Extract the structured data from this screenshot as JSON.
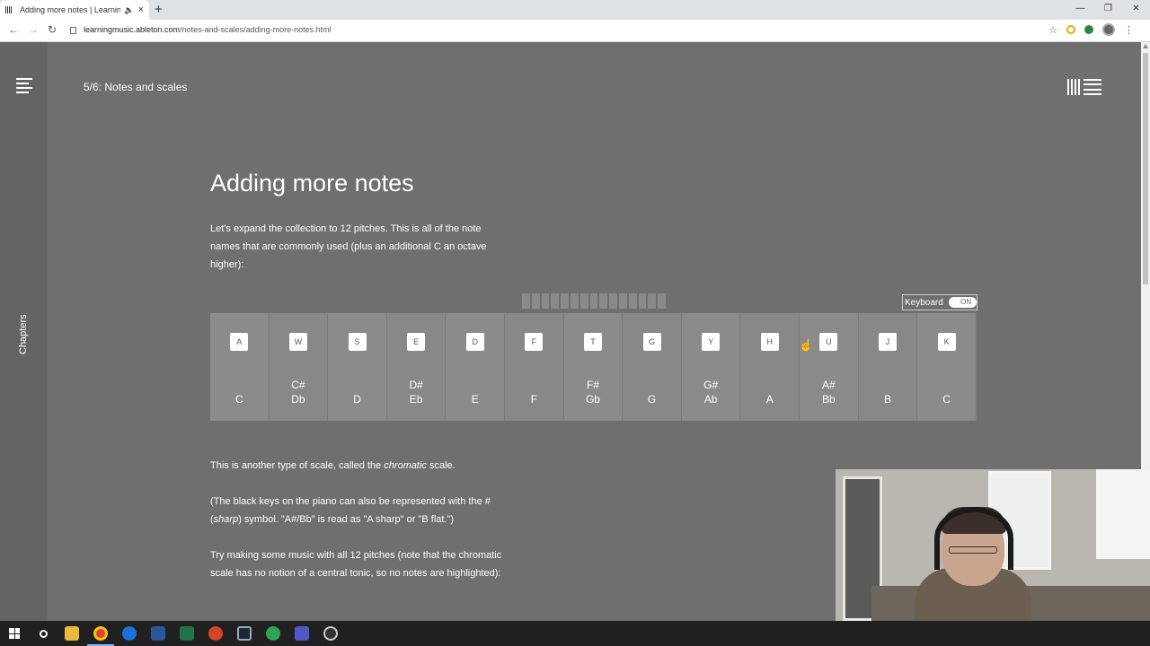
{
  "browser": {
    "tab_title": "Adding more notes | Learnin",
    "tab_close": "×",
    "new_tab": "+",
    "url_host": "learningmusic.ableton.com",
    "url_path": "/notes-and-scales/adding-more-notes.html",
    "win_minimize": "—",
    "win_restore": "❐",
    "win_close": "✕"
  },
  "sidebar": {
    "chapters_label": "Chapters"
  },
  "header": {
    "breadcrumb": "5/6: Notes and scales"
  },
  "main": {
    "title": "Adding more notes",
    "intro": "Let's expand the collection to 12 pitches. This is all of the note names that are commonly used (plus an additional C an octave higher):",
    "chromatic_pre": "This is another type of scale, called the ",
    "chromatic_em": "chromatic",
    "chromatic_post": " scale.",
    "black_keys_pre": "(The black keys on the piano can also be represented with the # (",
    "black_keys_em": "sharp",
    "black_keys_post": ") symbol. \"A#/Bb\" is read as \"A sharp\" or \"B flat.\")",
    "try_text": "Try making some music with all 12 pitches (note that the chromatic scale has no notion of a central tonic, so no notes are highlighted):"
  },
  "keyboard_toggle": {
    "label": "Keyboard",
    "state": "ON"
  },
  "keys": [
    {
      "letter": "A",
      "note1": "C",
      "note2": ""
    },
    {
      "letter": "W",
      "note1": "C#",
      "note2": "Db"
    },
    {
      "letter": "S",
      "note1": "D",
      "note2": ""
    },
    {
      "letter": "E",
      "note1": "D#",
      "note2": "Eb"
    },
    {
      "letter": "D",
      "note1": "E",
      "note2": ""
    },
    {
      "letter": "F",
      "note1": "F",
      "note2": ""
    },
    {
      "letter": "T",
      "note1": "F#",
      "note2": "Gb"
    },
    {
      "letter": "G",
      "note1": "G",
      "note2": ""
    },
    {
      "letter": "Y",
      "note1": "G#",
      "note2": "Ab"
    },
    {
      "letter": "H",
      "note1": "A",
      "note2": ""
    },
    {
      "letter": "U",
      "note1": "A#",
      "note2": "Bb"
    },
    {
      "letter": "J",
      "note1": "B",
      "note2": ""
    },
    {
      "letter": "K",
      "note1": "C",
      "note2": ""
    }
  ],
  "colors": {
    "page_bg": "#6f6f6f",
    "sidebar_bg": "#646464",
    "key_bg": "#888888"
  }
}
